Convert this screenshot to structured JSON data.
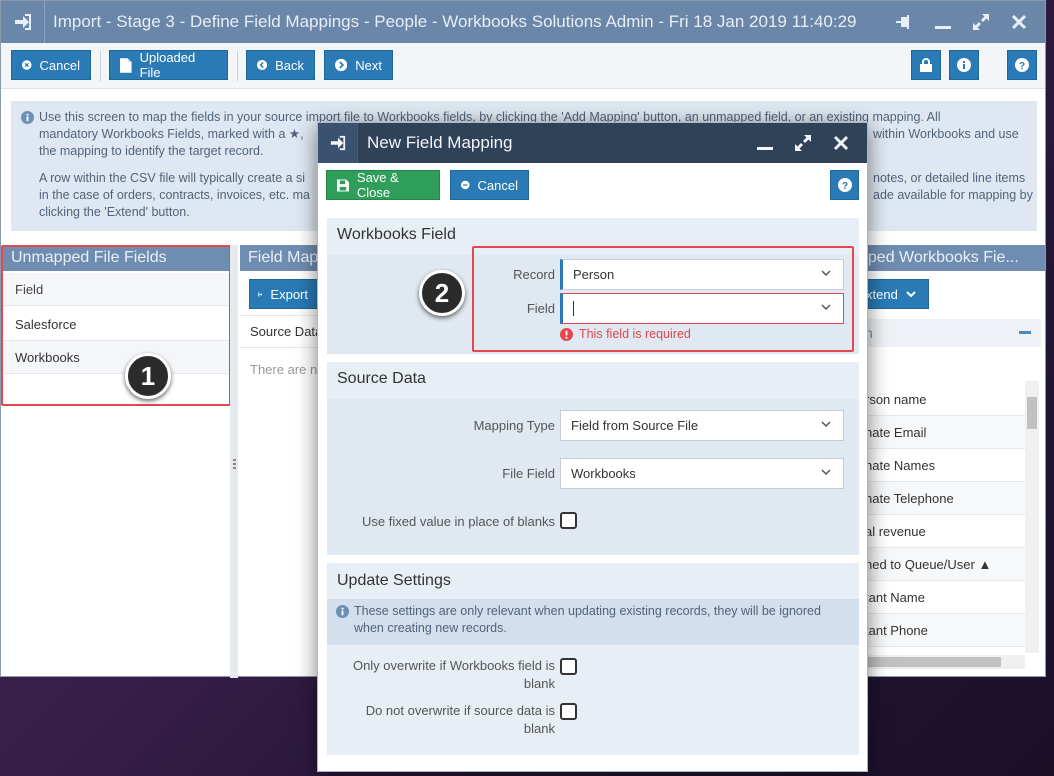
{
  "main_window": {
    "title": "Import - Stage 3 - Define Field Mappings - People - Workbooks Solutions Admin - Fri 18 Jan 2019 11:40:29"
  },
  "toolbar": {
    "cancel_label": "Cancel",
    "uploaded_file_label": "Uploaded File",
    "back_label": "Back",
    "next_label": "Next"
  },
  "info": {
    "para1_line1": "Use this screen to map the fields in your source import file to Workbooks fields, by clicking the 'Add Mapping' button, an unmapped field, or an existing mapping. All",
    "para1_line2_left": "mandatory Workbooks Fields, marked with a ★,",
    "para1_line2_right": "within Workbooks and use",
    "para1_line3": "the mapping to identify the target record.",
    "para2_line1_left": "A row within the CSV file will typically create a si",
    "para2_line1_right": "notes, or detailed line items",
    "para2_line2_left": "in the case of orders, contracts, invoices, etc. ma",
    "para2_line2_right": "ade available for mapping by",
    "para2_line3": "clicking the 'Extend' button."
  },
  "unmapped": {
    "header": "Unmapped File Fields",
    "column_header": "Field",
    "items": [
      "Salesforce",
      "Workbooks"
    ]
  },
  "field_mappings": {
    "header": "Field Map",
    "export_label": "Export",
    "column_header": "Source Data",
    "empty_text": "There are n"
  },
  "mapped_workbooks": {
    "header": "pped Workbooks Fie...",
    "extend_label": "xtend",
    "column_header": "n",
    "rows": [
      "rson name",
      "nate Email",
      "nate Names",
      "nate Telephone",
      "al revenue",
      "ned to Queue/User ▲",
      "tant Name",
      "tant Phone"
    ]
  },
  "annotations": {
    "badge1": "1",
    "badge2": "2"
  },
  "modal": {
    "title": "New Field Mapping",
    "save_close_label": "Save & Close",
    "cancel_label": "Cancel",
    "workbooks_field": {
      "title": "Workbooks Field",
      "record_label": "Record",
      "record_value": "Person",
      "field_label": "Field",
      "field_value": "",
      "error": "This field is required"
    },
    "source_data": {
      "title": "Source Data",
      "mapping_type_label": "Mapping Type",
      "mapping_type_value": "Field from Source File",
      "file_field_label": "File Field",
      "file_field_value": "Workbooks",
      "fixed_value_label": "Use fixed value in place of blanks"
    },
    "update_settings": {
      "title": "Update Settings",
      "info_line1": "These settings are only relevant when updating existing records, they will be ignored",
      "info_line2": "when creating new records.",
      "only_overwrite_line1": "Only overwrite if Workbooks field is",
      "only_overwrite_line2": "blank",
      "do_not_overwrite_line1": "Do not overwrite if source data is",
      "do_not_overwrite_line2": "blank"
    }
  },
  "colors": {
    "titlebar": "#6a86a8",
    "button": "#2a7ab5",
    "save_button": "#2e9e5a",
    "modal_titlebar": "#2f4258",
    "error": "#e4474d"
  }
}
